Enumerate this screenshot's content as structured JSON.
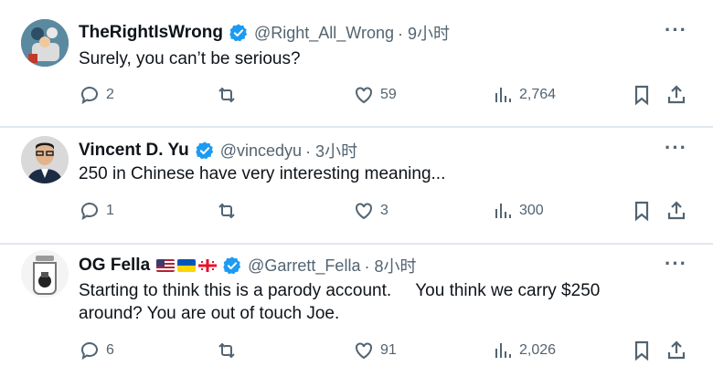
{
  "tweets": [
    {
      "name": "TheRightIsWrong",
      "handle": "@Right_All_Wrong",
      "time": "· 9小时",
      "text": "Surely, you can’t be serious?",
      "replies": "2",
      "retweets": "",
      "likes": "59",
      "views": "2,764",
      "flags": []
    },
    {
      "name": "Vincent D. Yu",
      "handle": "@vincedyu",
      "time": "· 3小时",
      "text": "250 in Chinese have very interesting meaning...",
      "replies": "1",
      "retweets": "",
      "likes": "3",
      "views": "300",
      "flags": []
    },
    {
      "name": "OG Fella",
      "handle": "@Garrett_Fella",
      "time": "· 8小时",
      "text_line1": "Starting to think this is a parody account.     You think we carry $250",
      "text_line2": "around? You are out of touch Joe.",
      "replies": "6",
      "retweets": "",
      "likes": "91",
      "views": "2,026",
      "flags": [
        "us-flag",
        "ukraine-flag",
        "georgia-flag"
      ]
    }
  ],
  "icons": {
    "verified": "verified-badge-icon",
    "more": "more-options-icon",
    "reply": "reply-icon",
    "retweet": "retweet-icon",
    "like": "heart-icon",
    "views": "views-icon",
    "bookmark": "bookmark-icon",
    "share": "share-icon"
  },
  "colors": {
    "verified": "#1d9bf0",
    "secondary_text": "#536471",
    "primary_text": "#0f1419",
    "divider": "#e1e8ed"
  },
  "more_label": "···"
}
